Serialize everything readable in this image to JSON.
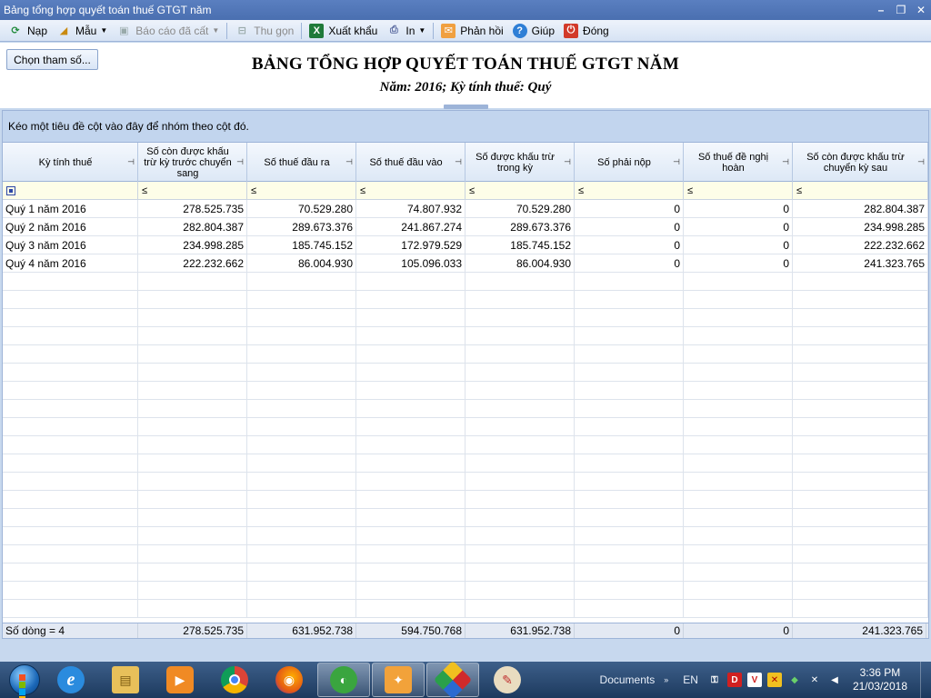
{
  "window": {
    "title": "Bảng tổng hợp quyết toán thuế GTGT năm"
  },
  "toolbar": {
    "nap": "Nạp",
    "mau": "Mẫu",
    "bao_cao_da_cat": "Báo cáo đã cất",
    "thu_gon": "Thu gọn",
    "xuat_khau": "Xuất khẩu",
    "in": "In",
    "phan_hoi": "Phản hồi",
    "giup": "Giúp",
    "dong": "Đóng"
  },
  "header": {
    "param_button": "Chọn tham số...",
    "title": "BẢNG TỔNG HỢP QUYẾT TOÁN THUẾ GTGT NĂM",
    "subtitle": "Năm: 2016; Kỳ tính thuế: Quý"
  },
  "group_panel": {
    "hint": "Kéo một tiêu đề cột vào đây để nhóm theo cột đó."
  },
  "grid": {
    "columns": [
      "Kỳ tính thuế",
      "Số còn được khấu trừ kỳ trước chuyển sang",
      "Số thuế đầu ra",
      "Số thuế đầu vào",
      "Số được khấu trừ trong kỳ",
      "Số phải nộp",
      "Số thuế đề nghị hoàn",
      "Số còn được khấu trừ chuyển kỳ sau"
    ],
    "filter_op": "≤",
    "rows": [
      [
        "Quý 1 năm 2016",
        "278.525.735",
        "70.529.280",
        "74.807.932",
        "70.529.280",
        "0",
        "0",
        "282.804.387"
      ],
      [
        "Quý 2 năm 2016",
        "282.804.387",
        "289.673.376",
        "241.867.274",
        "289.673.376",
        "0",
        "0",
        "234.998.285"
      ],
      [
        "Quý 3 năm 2016",
        "234.998.285",
        "185.745.152",
        "172.979.529",
        "185.745.152",
        "0",
        "0",
        "222.232.662"
      ],
      [
        "Quý 4 năm 2016",
        "222.232.662",
        "86.004.930",
        "105.096.033",
        "86.004.930",
        "0",
        "0",
        "241.323.765"
      ]
    ],
    "footer": [
      "Số dòng = 4",
      "278.525.735",
      "631.952.738",
      "594.750.768",
      "631.952.738",
      "0",
      "0",
      "241.323.765"
    ]
  },
  "taskbar": {
    "documents": "Documents",
    "language": "EN",
    "time": "3:36 PM",
    "date": "21/03/2018"
  },
  "colors": {
    "accent": "#4a6fb0",
    "panel": "#c2d5ee",
    "filter_row": "#fdfde8"
  }
}
